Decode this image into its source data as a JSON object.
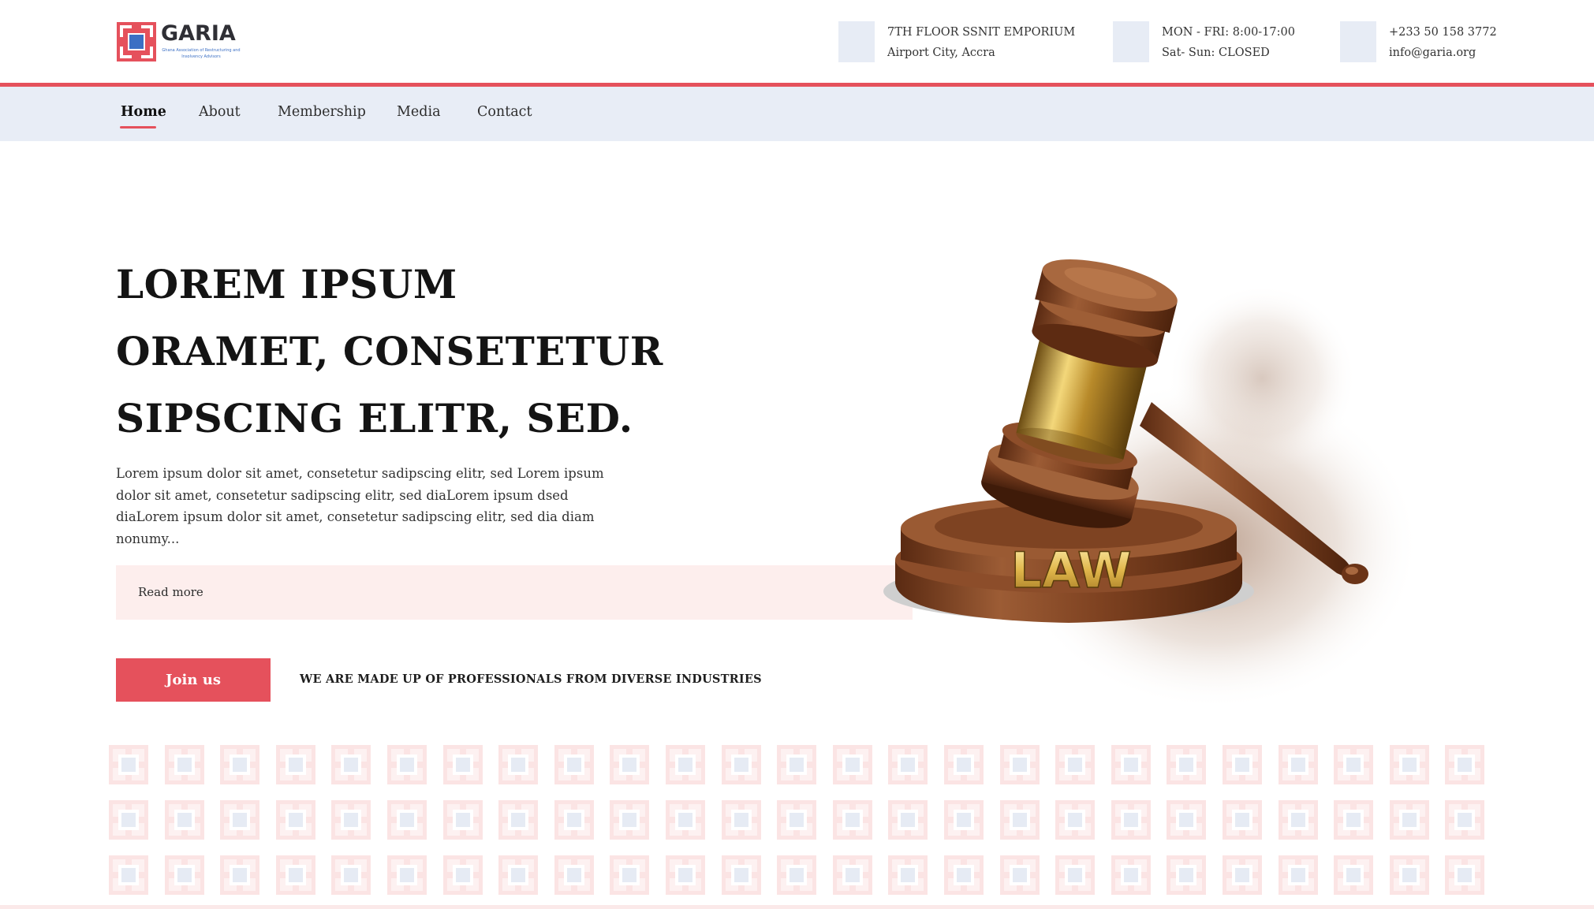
{
  "brand": {
    "name": "GARIA",
    "tagline": "Ghana Association of Restructuring and Insolvency Advisors",
    "primary_color": "#e5515c",
    "secondary_color": "#3b6fc4"
  },
  "header": {
    "address": {
      "line1": "7TH FLOOR SSNIT EMPORIUM",
      "line2": "Airport City, Accra",
      "icon": "location-icon"
    },
    "hours": {
      "line1": "MON - FRI: 8:00-17:00",
      "line2": "Sat- Sun: CLOSED",
      "icon": "clock-icon"
    },
    "contact": {
      "line1": "+233 50 158 3772",
      "line2": "info@garia.org",
      "icon": "phone-icon"
    }
  },
  "nav": {
    "items": [
      {
        "label": "Home",
        "active": true
      },
      {
        "label": "About",
        "active": false
      },
      {
        "label": "Membership",
        "active": false
      },
      {
        "label": "Media",
        "active": false
      },
      {
        "label": "Contact",
        "active": false
      }
    ]
  },
  "hero": {
    "title_lines": [
      "LOREM IPSUM",
      "ORAMET, CONSETETUR",
      "SIPSCING ELITR, SED."
    ],
    "body": "Lorem ipsum dolor sit amet, consetetur sadipscing elitr, sed Lorem ipsum dolor sit amet, consetetur sadipscing elitr, sed diaLorem ipsum dsed diaLorem ipsum dolor sit amet, consetetur sadipscing elitr, sed dia diam nonumy...",
    "read_more": "Read more",
    "join_label": "Join us",
    "tagline": "WE ARE MADE UP OF PROFESSIONALS FROM DIVERSE INDUSTRIES",
    "image_label": "LAW"
  }
}
